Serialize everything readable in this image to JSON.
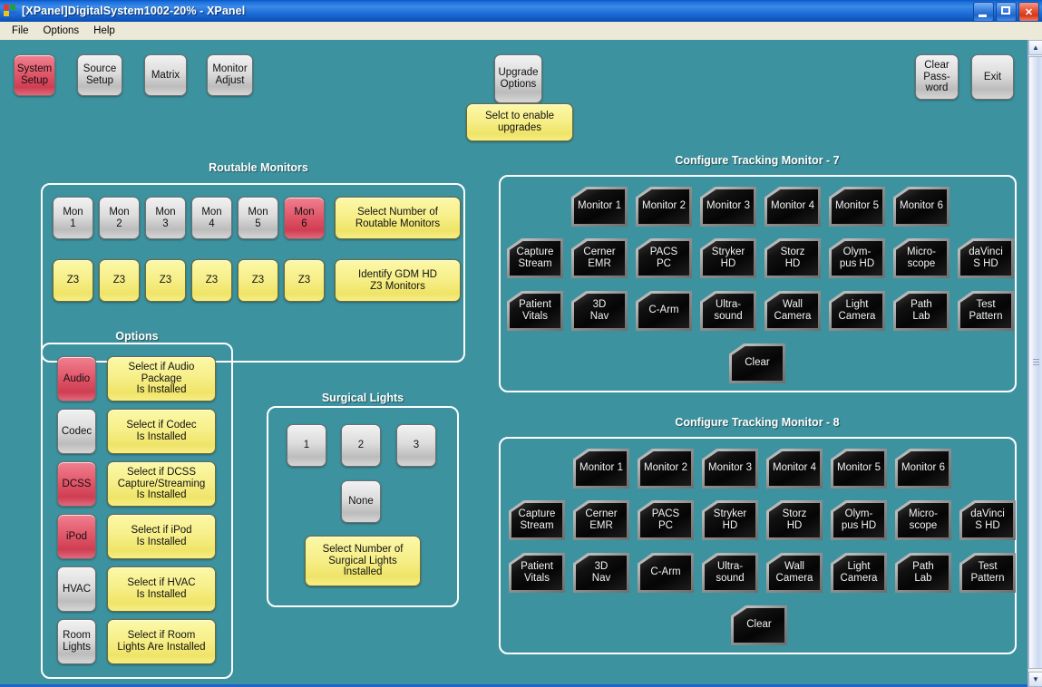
{
  "window": {
    "title": "[XPanel]DigitalSystem1002-20% - XPanel",
    "icon": "app-logo-icon",
    "minimize_label": "minimize-icon",
    "maximize_label": "maximize-icon",
    "close_label": "✕"
  },
  "menubar": {
    "items": [
      "File",
      "Options",
      "Help"
    ]
  },
  "colors": {
    "background": "#3d929f",
    "accent_red": "#e2586b",
    "accent_yellow": "#f7ef8a",
    "accent_gray": "#dcdcdc",
    "panel_border": "#ffffff",
    "titlebar_blue": "#1a6ddb"
  },
  "toolbar": {
    "buttons": [
      {
        "label": "System\nSetup",
        "state": "red"
      },
      {
        "label": "Source\nSetup",
        "state": "gray"
      },
      {
        "label": "Matrix",
        "state": "gray"
      },
      {
        "label": "Monitor\nAdjust",
        "state": "gray"
      }
    ],
    "upgrade": {
      "label": "Upgrade\nOptions",
      "state": "gray"
    },
    "upgrade_hint": "Selct to enable\nupgrades",
    "right_buttons": [
      {
        "label": "Clear\nPass-\nword",
        "state": "gray"
      },
      {
        "label": "Exit",
        "state": "gray"
      }
    ]
  },
  "routable_monitors": {
    "title": "Routable Monitors",
    "monitors": [
      {
        "label": "Mon\n1",
        "state": "gray"
      },
      {
        "label": "Mon\n2",
        "state": "gray"
      },
      {
        "label": "Mon\n3",
        "state": "gray"
      },
      {
        "label": "Mon\n4",
        "state": "gray"
      },
      {
        "label": "Mon\n5",
        "state": "gray"
      },
      {
        "label": "Mon\n6",
        "state": "red"
      }
    ],
    "select_hint": "Select Number of\nRoutable Monitors",
    "z3_buttons": [
      "Z3",
      "Z3",
      "Z3",
      "Z3",
      "Z3",
      "Z3"
    ],
    "identify_hint": "Identify GDM HD\nZ3 Monitors"
  },
  "options": {
    "title": "Options",
    "rows": [
      {
        "key": "Audio",
        "state": "red",
        "hint": "Select if Audio\nPackage\nIs Installed"
      },
      {
        "key": "Codec",
        "state": "gray",
        "hint": "Select if Codec\nIs Installed"
      },
      {
        "key": "DCSS",
        "state": "red",
        "hint": "Select if DCSS\nCapture/Streaming\nIs Installed"
      },
      {
        "key": "iPod",
        "state": "red",
        "hint": "Select if iPod\nIs Installed"
      },
      {
        "key": "HVAC",
        "state": "gray",
        "hint": "Select if HVAC\nIs Installed"
      },
      {
        "key": "Room\nLights",
        "state": "gray",
        "hint": "Select if Room\nLights Are Installed"
      }
    ]
  },
  "surgical_lights": {
    "title": "Surgical Lights",
    "counts": [
      "1",
      "2",
      "3"
    ],
    "none_label": "None",
    "hint": "Select Number of\nSurgical Lights\nInstalled"
  },
  "tracking_monitor_7": {
    "title": "Configure Tracking Monitor - 7",
    "row1": [
      "Monitor 1",
      "Monitor 2",
      "Monitor 3",
      "Monitor 4",
      "Monitor 5",
      "Monitor 6"
    ],
    "row2": [
      "Capture\nStream",
      "Cerner\nEMR",
      "PACS\nPC",
      "Stryker\nHD",
      "Storz\nHD",
      "Olym-\npus HD",
      "Micro-\nscope",
      "daVinci\nS HD"
    ],
    "row3": [
      "Patient\nVitals",
      "3D\nNav",
      "C-Arm",
      "Ultra-\nsound",
      "Wall\nCamera",
      "Light\nCamera",
      "Path\nLab",
      "Test\nPattern"
    ],
    "clear_label": "Clear"
  },
  "tracking_monitor_8": {
    "title": "Configure Tracking Monitor - 8",
    "row1": [
      "Monitor 1",
      "Monitor 2",
      "Monitor 3",
      "Monitor 4",
      "Monitor 5",
      "Monitor 6"
    ],
    "row2": [
      "Capture\nStream",
      "Cerner\nEMR",
      "PACS\nPC",
      "Stryker\nHD",
      "Storz\nHD",
      "Olym-\npus HD",
      "Micro-\nscope",
      "daVinci\nS HD"
    ],
    "row3": [
      "Patient\nVitals",
      "3D\nNav",
      "C-Arm",
      "Ultra-\nsound",
      "Wall\nCamera",
      "Light\nCamera",
      "Path\nLab",
      "Test\nPattern"
    ],
    "clear_label": "Clear"
  }
}
